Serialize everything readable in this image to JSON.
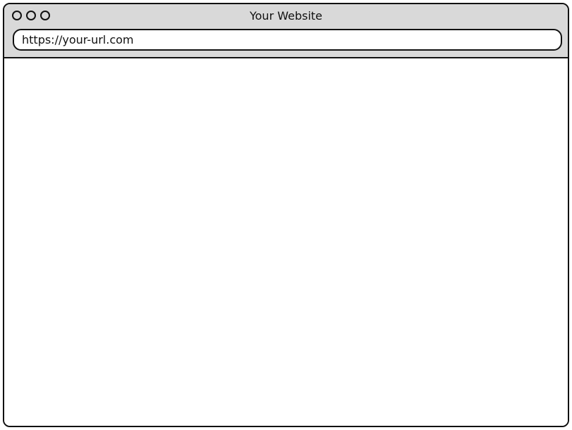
{
  "window": {
    "title": "Your Website"
  },
  "addressbar": {
    "url": "https://your-url.com"
  },
  "colors": {
    "chrome_background": "#d9d9d9",
    "outline": "#111111",
    "content_background": "#ffffff"
  }
}
